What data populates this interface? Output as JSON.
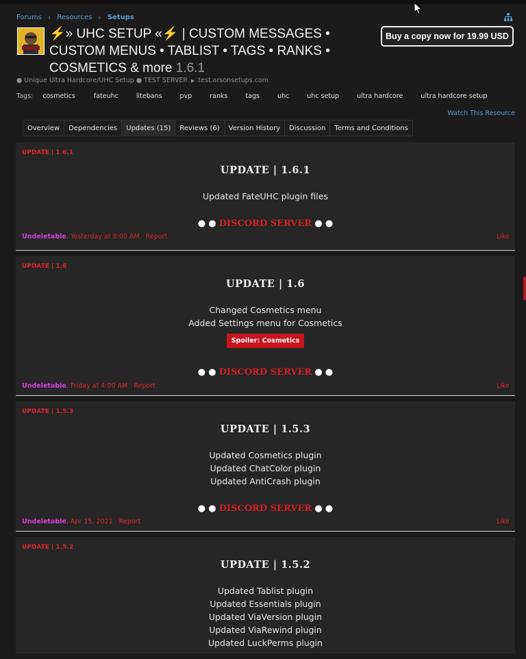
{
  "breadcrumb": [
    {
      "label": "Forums"
    },
    {
      "label": "Resources"
    },
    {
      "label": "Setups"
    }
  ],
  "resource": {
    "title": "⚡» UHC SETUP «⚡ | CUSTOM MESSAGES • CUSTOM MENUS • TABLIST • TAGS • RANKS • COSMETICS & more",
    "version": "1.6.1",
    "buy_label": "Buy a copy now for 19.99 USD",
    "subline": {
      "tagline": "● Unique Ultra Hardcore/UHC Setup ● TEST SERVER",
      "arrow": "▶",
      "server": "test.arsonsetups.com"
    },
    "tags_label": "Tags:",
    "tags": [
      "cosmetics",
      "fateuhc",
      "litebans",
      "pvp",
      "ranks",
      "tags",
      "uhc",
      "uhc setup",
      "ultra hardcore",
      "ultra hardcore setup"
    ],
    "watch_label": "Watch This Resource"
  },
  "tabs": [
    {
      "label": "Overview",
      "active": false
    },
    {
      "label": "Dependencies",
      "active": false
    },
    {
      "label": "Updates (15)",
      "active": true
    },
    {
      "label": "Reviews (6)",
      "active": false
    },
    {
      "label": "Version History",
      "active": false
    },
    {
      "label": "Discussion",
      "active": false
    },
    {
      "label": "Terms and Conditions",
      "active": false
    }
  ],
  "updates": [
    {
      "label": "UPDATE | 1.6.1",
      "heading": "UPDATE | 1.6.1",
      "lines": [
        "Updated FateUHC plugin files"
      ],
      "spoiler": "",
      "discord": {
        "bullets": "● ●",
        "name": "DISCORD SERVER"
      },
      "author": "Undeletable",
      "date": ", Yesterday at 8:00 AM",
      "report": "Report",
      "like": "Like"
    },
    {
      "label": "UPDATE | 1.6",
      "heading": "UPDATE | 1.6",
      "lines": [
        "Changed Cosmetics menu",
        "Added Settings menu for Cosmetics"
      ],
      "spoiler": "Spoiler: Cosmetics",
      "discord": {
        "bullets": "● ●",
        "name": "DISCORD SERVER"
      },
      "author": "Undeletable",
      "date": ", Friday at 4:00 AM",
      "report": "Report",
      "like": "Like"
    },
    {
      "label": "UPDATE | 1.5.3",
      "heading": "UPDATE | 1.5.3",
      "lines": [
        "Updated Cosmetics plugin",
        "Updated ChatColor plugin",
        "Updated AntiCrash plugin"
      ],
      "spoiler": "",
      "discord": {
        "bullets": "● ●",
        "name": "DISCORD SERVER"
      },
      "author": "Undeletable",
      "date": ", Apr 15, 2021",
      "report": "Report",
      "like": "Like"
    },
    {
      "label": "UPDATE | 1.5.2",
      "heading": "UPDATE | 1.5.2",
      "lines": [
        "Updated Tablist plugin",
        "Updated Essentials plugin",
        "Updated ViaVersion plugin",
        "Updated ViaRewind plugin",
        "Updated LuckPerms plugin"
      ],
      "spoiler": "",
      "discord": null,
      "author": "",
      "date": "",
      "report": "",
      "like": ""
    }
  ],
  "colors": {
    "accent_red": "#d9262e",
    "link_blue": "#5a9ad6",
    "author_purple": "#d43fd6",
    "background": "#1b1b1b",
    "card": "#262626"
  },
  "icons": {
    "sitemap": "sitemap-icon",
    "cursor": "mouse-pointer-icon",
    "logo": "resource-logo-icon"
  }
}
